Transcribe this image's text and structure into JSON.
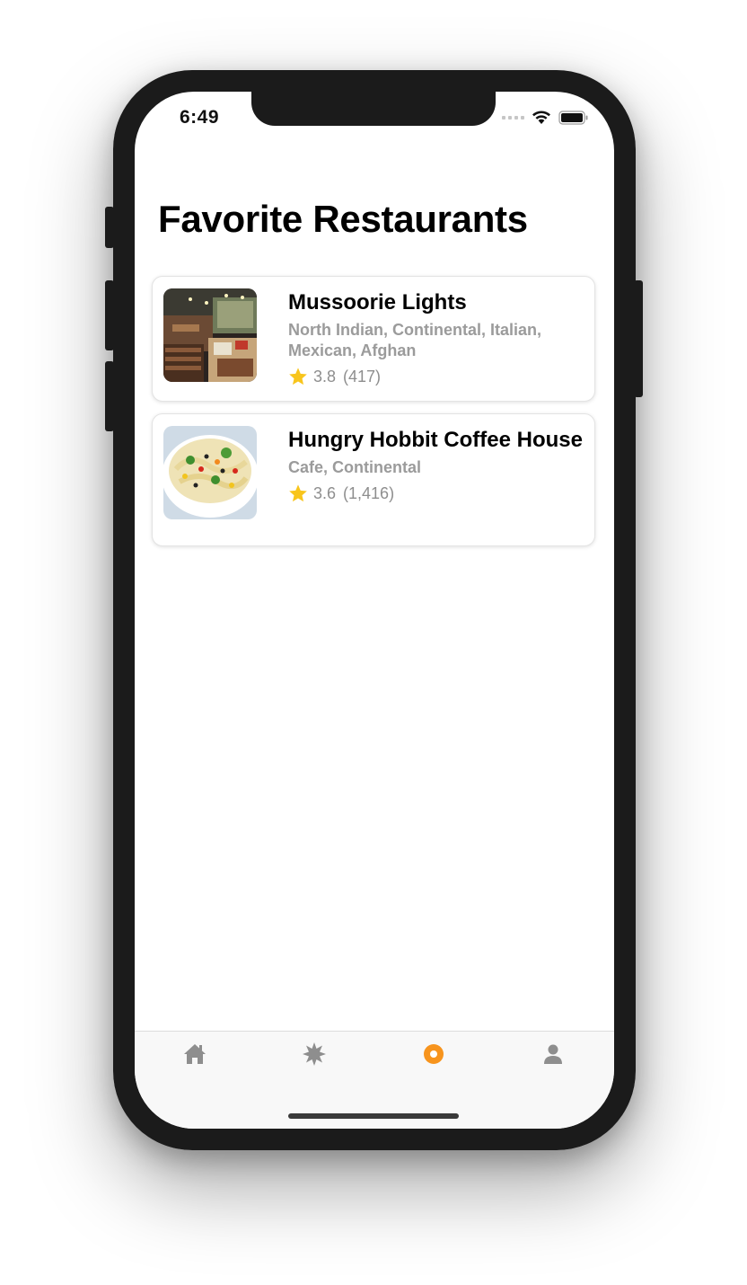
{
  "status_bar": {
    "time": "6:49",
    "icons": [
      "signal-icon",
      "wifi-icon",
      "battery-icon"
    ]
  },
  "page": {
    "title": "Favorite Restaurants"
  },
  "restaurants": [
    {
      "name": "Mussoorie Lights",
      "cuisines": "North Indian, Continental, Italian, Mexican, Afghan",
      "rating": "3.8",
      "reviews": "(417)",
      "image": "restaurant-interior-photo"
    },
    {
      "name": "Hungry Hobbit Coffee House",
      "cuisines": "Cafe, Continental",
      "rating": "3.6",
      "reviews": "(1,416)",
      "image": "pasta-bowl-photo"
    }
  ],
  "tab_bar": {
    "tabs": [
      {
        "icon": "home-icon",
        "active": false
      },
      {
        "icon": "discover-starburst-icon",
        "active": false
      },
      {
        "icon": "favorites-circle-icon",
        "active": true
      },
      {
        "icon": "profile-icon",
        "active": false
      }
    ],
    "active_color": "#f7941d",
    "inactive_color": "#8e8e8e"
  },
  "colors": {
    "star": "#f8c51c",
    "secondary_text": "#9b9b9b"
  }
}
